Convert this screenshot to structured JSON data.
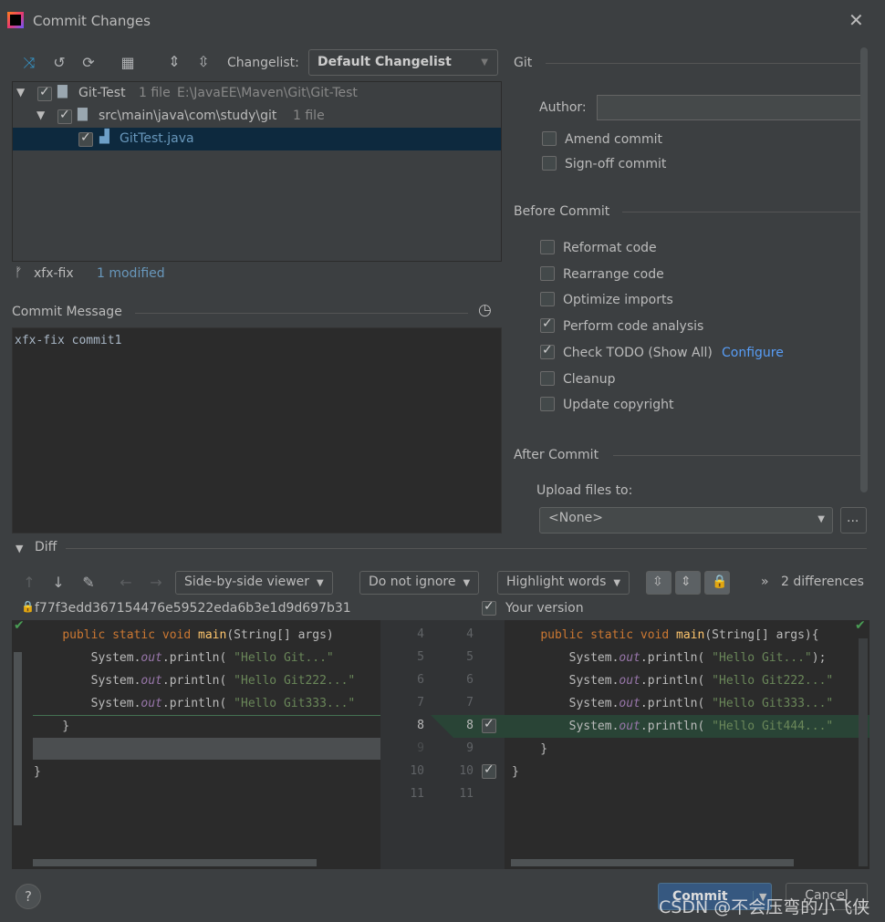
{
  "title": "Commit Changes",
  "toolbar": {
    "changelist_label": "Changelist:",
    "changelist_value": "Default Changelist"
  },
  "tree": [
    {
      "name": "Git-Test",
      "count": "1 file",
      "path": "E:\\JavaEE\\Maven\\Git\\Git-Test"
    },
    {
      "name": "src\\main\\java\\com\\study\\git",
      "count": "1 file"
    },
    {
      "name": "GitTest.java"
    }
  ],
  "branch": "xfx-fix",
  "modified": "1 modified",
  "commit_message_label": "Commit Message",
  "commit_message": "xfx-fix commit1",
  "git": {
    "section": "Git",
    "author_label": "Author:",
    "author_value": "",
    "amend": "Amend commit",
    "signoff": "Sign-off commit"
  },
  "before_commit": {
    "section": "Before Commit",
    "options": [
      {
        "label": "Reformat code",
        "checked": false
      },
      {
        "label": "Rearrange code",
        "checked": false
      },
      {
        "label": "Optimize imports",
        "checked": false
      },
      {
        "label": "Perform code analysis",
        "checked": true
      },
      {
        "label": "Check TODO (Show All)",
        "checked": true,
        "link": "Configure"
      },
      {
        "label": "Cleanup",
        "checked": false
      },
      {
        "label": "Update copyright",
        "checked": false
      }
    ]
  },
  "after_commit": {
    "section": "After Commit",
    "upload_label": "Upload files to:",
    "upload_value": "<None>",
    "more": "..."
  },
  "diff": {
    "section": "Diff",
    "viewer": "Side-by-side viewer",
    "ignore": "Do not ignore",
    "highlight": "Highlight words",
    "differences": "2 differences",
    "left_title": "f77f3edd367154476e59522eda6b3e1d9d697b31",
    "right_title": "Your version",
    "left_nums": [
      "4",
      "5",
      "6",
      "7",
      "8",
      "9",
      "10",
      "11"
    ],
    "right_nums": [
      "4",
      "5",
      "6",
      "7",
      "8",
      "9",
      "10",
      "11"
    ]
  },
  "buttons": {
    "commit": "Commit",
    "cancel": "Cancel",
    "help": "?"
  },
  "watermark": "CSDN @不会压弯的小飞侠",
  "colors": {
    "accent": "#589df6",
    "selection": "#0d293e",
    "inserted": "#294436"
  }
}
